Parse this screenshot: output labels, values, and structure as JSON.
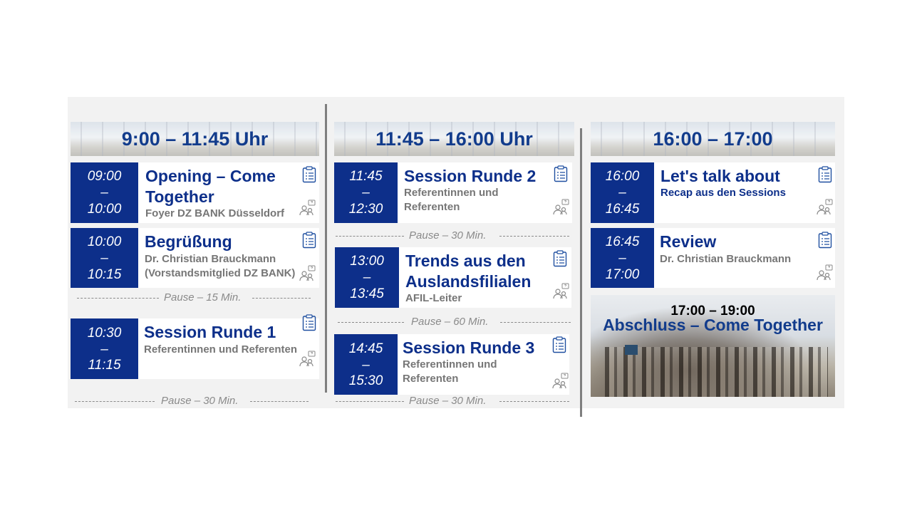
{
  "columns": [
    {
      "header": "9:00 – 11:45 Uhr"
    },
    {
      "header": "11:45 – 16:00 Uhr"
    },
    {
      "header": "16:00 – 17:00"
    }
  ],
  "sessions": [
    {
      "start": "09:00",
      "dash": "–",
      "end": "10:00",
      "title_l1": "Opening – Come",
      "title_l2": "Together",
      "sub_l1": "Foyer DZ BANK Düsseldorf"
    },
    {
      "start": "10:00",
      "dash": "–",
      "end": "10:15",
      "title_l1": "Begrüßung",
      "sub_l1": "Dr. Christian Brauckmann",
      "sub_l2": "(Vorstandsmitglied DZ BANK)"
    },
    {
      "start": "10:30",
      "dash": "–",
      "end": "11:15",
      "title_l1": "Session Runde 1",
      "sub_l1": "Referentinnen und Referenten"
    },
    {
      "start": "11:45",
      "dash": "–",
      "end": "12:30",
      "title_l1": "Session Runde 2",
      "sub_l1": "Referentinnen und",
      "sub_l2": "Referenten"
    },
    {
      "start": "13:00",
      "dash": "–",
      "end": "13:45",
      "title_l1": "Trends aus den",
      "title_l2": "Auslandsfilialen",
      "sub_l1": "AFIL-Leiter"
    },
    {
      "start": "14:45",
      "dash": "–",
      "end": "15:30",
      "title_l1": "Session Runde 3",
      "sub_l1": "Referentinnen und",
      "sub_l2": "Referenten"
    },
    {
      "start": "16:00",
      "dash": "–",
      "end": "16:45",
      "title_l1": "Let's talk about",
      "sub_l1": "Recap aus den Sessions"
    },
    {
      "start": "16:45",
      "dash": "–",
      "end": "17:00",
      "title_l1": "Review",
      "sub_l1": "Dr. Christian Brauckmann"
    }
  ],
  "pauses": [
    "Pause – 15 Min.",
    "Pause – 30 Min.",
    "Pause – 30 Min.",
    "Pause – 60 Min.",
    "Pause – 30 Min."
  ],
  "closing": {
    "time": "17:00 – 19:00",
    "title": "Abschluss – Come Together"
  },
  "icons": {
    "agenda": "clipboard-icon",
    "speakers": "people-question-icon"
  },
  "colors": {
    "navy": "#0d2f8a",
    "grey_text": "#767676",
    "panel": "#f2f2f2"
  }
}
